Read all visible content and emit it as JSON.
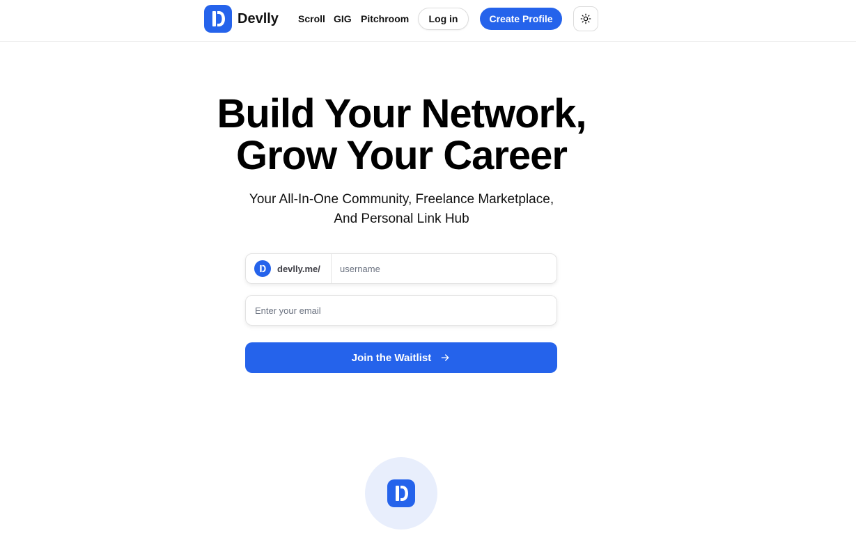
{
  "header": {
    "brand": "Devlly",
    "nav": [
      "Scroll",
      "GIG",
      "Pitchroom"
    ],
    "login_label": "Log in",
    "create_label": "Create Profile"
  },
  "hero": {
    "title_line1": "Build Your Network,",
    "title_line2": "Grow Your Career",
    "subtitle_line1": "Your All-In-One Community, Freelance Marketplace,",
    "subtitle_line2": "And Personal Link Hub"
  },
  "form": {
    "url_prefix": "devlly.me/",
    "username_placeholder": "username",
    "email_placeholder": "Enter your email",
    "submit_label": "Join the Waitlist"
  },
  "icons": {
    "logo": "devlly-logo-icon",
    "theme": "sun-icon",
    "submit_arrow": "arrow-right-icon"
  },
  "colors": {
    "accent": "#2563eb",
    "badge_bg": "#e8eefc"
  }
}
